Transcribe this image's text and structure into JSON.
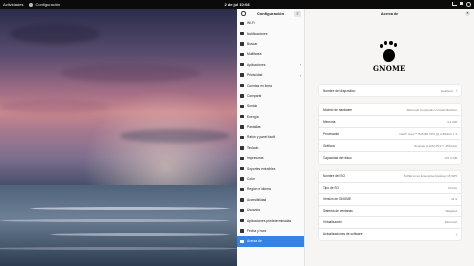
{
  "topbar": {
    "activities": "Actividades",
    "app_name": "Configuración",
    "clock": "2 de jul 10:08"
  },
  "sidebar": {
    "title": "Configuración",
    "items": [
      {
        "label": "Wi-Fi",
        "chevron": false
      },
      {
        "label": "Notificaciones",
        "chevron": false
      },
      {
        "label": "Buscar",
        "chevron": false
      },
      {
        "label": "Multitarea",
        "chevron": false
      },
      {
        "label": "Aplicaciones",
        "chevron": true
      },
      {
        "label": "Privacidad",
        "chevron": true
      },
      {
        "label": "Cuentas en línea",
        "chevron": false
      },
      {
        "label": "Compartir",
        "chevron": false
      },
      {
        "label": "Sonido",
        "chevron": false
      },
      {
        "label": "Energía",
        "chevron": false
      },
      {
        "label": "Pantallas",
        "chevron": false
      },
      {
        "label": "Ratón y panel táctil",
        "chevron": false
      },
      {
        "label": "Teclado",
        "chevron": false
      },
      {
        "label": "Impresoras",
        "chevron": false
      },
      {
        "label": "Soportes extraíbles",
        "chevron": false
      },
      {
        "label": "Color",
        "chevron": false
      },
      {
        "label": "Región e idioma",
        "chevron": false
      },
      {
        "label": "Accesibilidad",
        "chevron": false
      },
      {
        "label": "Usuarios",
        "chevron": false
      },
      {
        "label": "Aplicaciones predeterminadas",
        "chevron": false
      },
      {
        "label": "Fecha y hora",
        "chevron": false
      },
      {
        "label": "Acerca de",
        "chevron": false,
        "active": true
      }
    ]
  },
  "main": {
    "title": "Acerca de",
    "logo_text": "GNOME",
    "device_name": {
      "label": "Nombre del dispositivo",
      "value": "localhost"
    },
    "hardware": [
      {
        "label": "Modelo de hardware",
        "value": "Microsoft Corporation Virtual Machine"
      },
      {
        "label": "Memoria",
        "value": "4,0 GiB"
      },
      {
        "label": "Procesador",
        "value": "Intel® Core™ i5-8400 CPU @ 2,80GHz × 4"
      },
      {
        "label": "Gráficos",
        "value": "llvmpipe (LLVM 15.0.7, 256 bits)"
      },
      {
        "label": "Capacidad del disco",
        "value": "137,4 GB"
      }
    ],
    "software": [
      {
        "label": "Nombre del SO",
        "value": "SUSE Linux Enterprise Desktop 15 SP5"
      },
      {
        "label": "Tipo de SO",
        "value": "64 bits"
      },
      {
        "label": "Versión de GNOME",
        "value": "41.9"
      },
      {
        "label": "Sistema de ventanas",
        "value": "Wayland"
      },
      {
        "label": "Virtualización",
        "value": "Microsoft"
      },
      {
        "label": "Actualizaciones de software",
        "value": ""
      }
    ]
  }
}
